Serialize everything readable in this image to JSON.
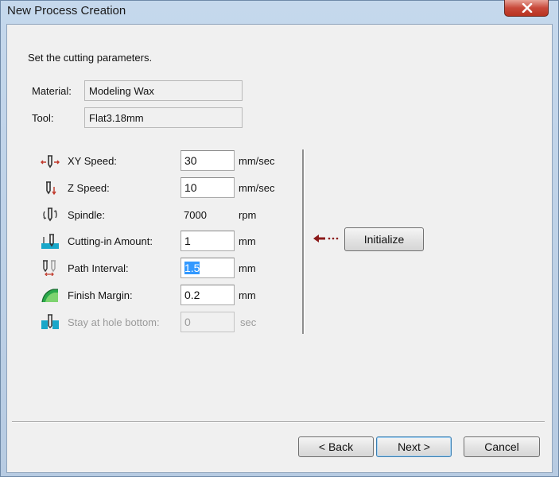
{
  "window": {
    "title": "New Process Creation"
  },
  "instruction": "Set the cutting parameters.",
  "info": {
    "material_label": "Material:",
    "material_value": "Modeling Wax",
    "tool_label": "Tool:",
    "tool_value": "Flat3.18mm"
  },
  "params": {
    "xy_speed": {
      "label": "XY Speed:",
      "value": "30",
      "unit": "mm/sec"
    },
    "z_speed": {
      "label": "Z Speed:",
      "value": "10",
      "unit": "mm/sec"
    },
    "spindle": {
      "label": "Spindle:",
      "value": "7000",
      "unit": "rpm"
    },
    "cutting_in": {
      "label": "Cutting-in Amount:",
      "value": "1",
      "unit": "mm"
    },
    "path_interval": {
      "label": "Path Interval:",
      "value": "1.5",
      "unit": "mm"
    },
    "finish_margin": {
      "label": "Finish Margin:",
      "value": "0.2",
      "unit": "mm"
    },
    "stay_hole": {
      "label": "Stay at hole bottom:",
      "value": "0",
      "unit": "sec"
    }
  },
  "buttons": {
    "initialize": "Initialize",
    "back": "< Back",
    "next": "Next >",
    "cancel": "Cancel"
  },
  "icons": {
    "xy_speed": "xy-speed-icon",
    "z_speed": "z-speed-icon",
    "spindle": "spindle-icon",
    "cutting_in": "cutting-in-icon",
    "path_interval": "path-interval-icon",
    "finish_margin": "finish-margin-icon",
    "stay_hole": "hole-bottom-icon",
    "initialize_arrow": "arrow-left-icon"
  },
  "colors": {
    "arrow": "#8b1a1a",
    "accent": "#3399ff",
    "icon_cyan": "#19a7c9",
    "icon_green": "#2aa84a"
  }
}
